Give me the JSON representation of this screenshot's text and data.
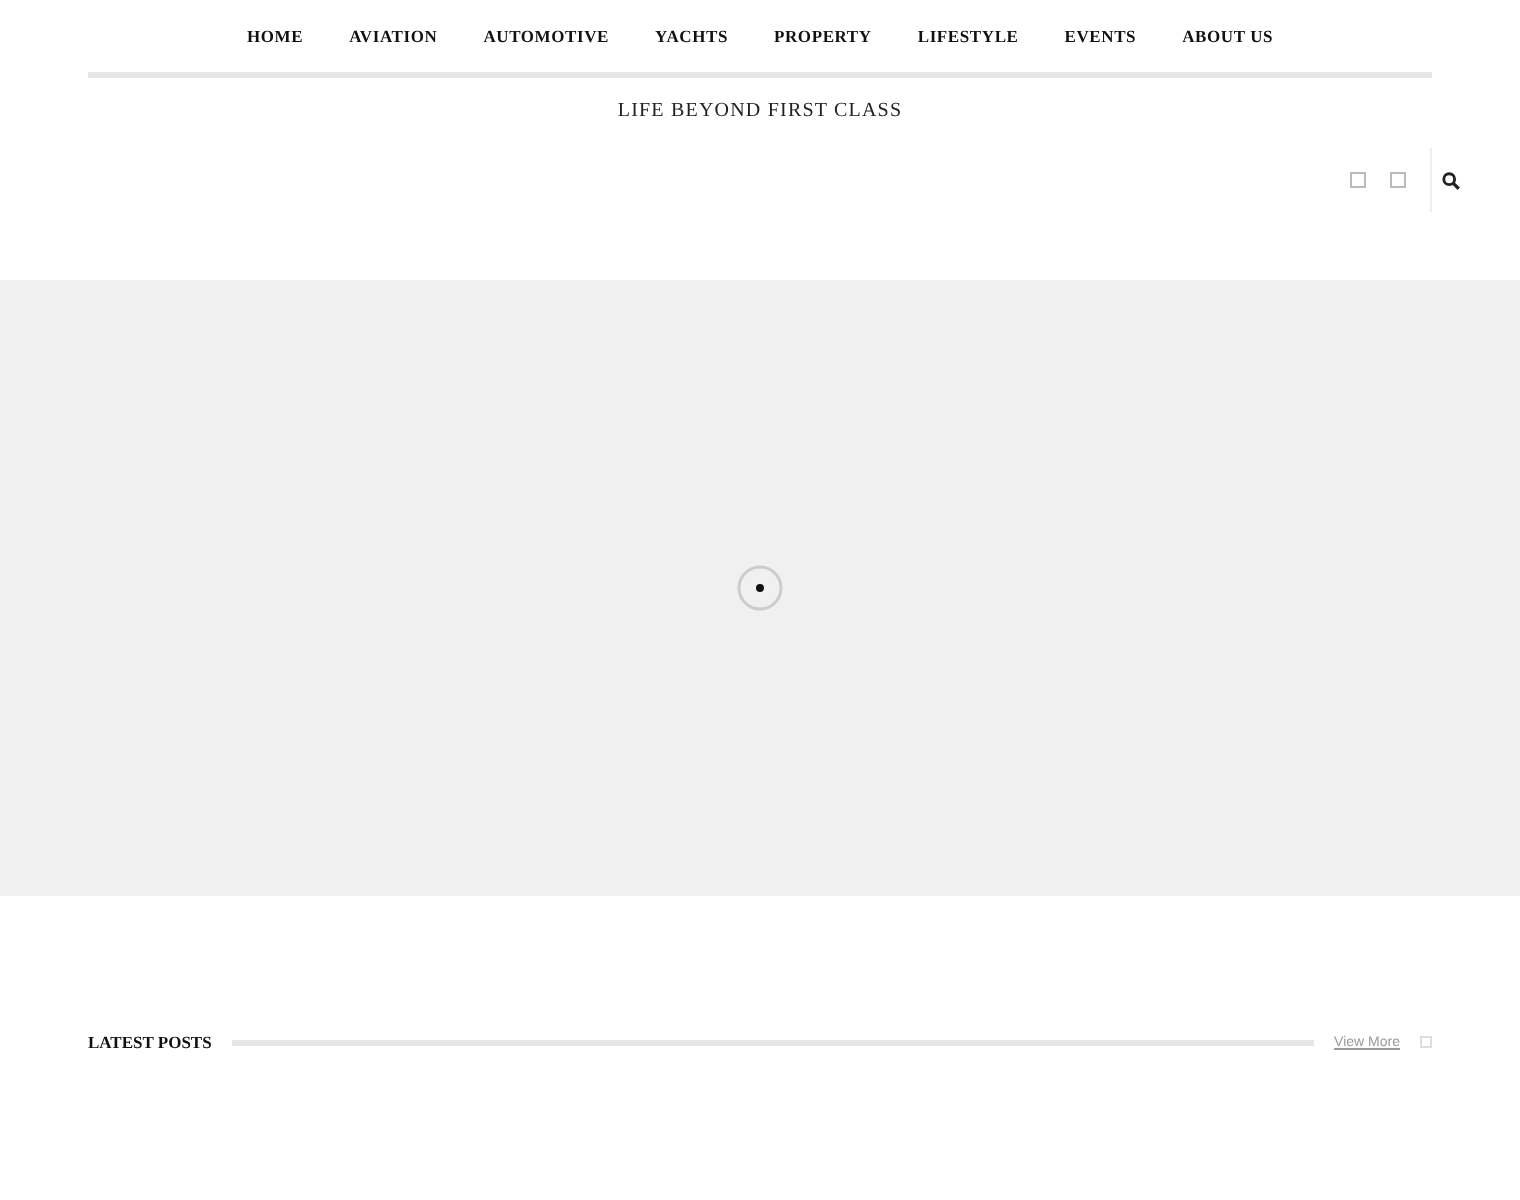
{
  "nav": {
    "items": [
      {
        "label": "HOME"
      },
      {
        "label": "AVIATION"
      },
      {
        "label": "AUTOMOTIVE"
      },
      {
        "label": "YACHTS"
      },
      {
        "label": "PROPERTY"
      },
      {
        "label": "LIFESTYLE"
      },
      {
        "label": "EVENTS"
      },
      {
        "label": "ABOUT US"
      }
    ]
  },
  "tagline": "LIFE BEYOND FIRST CLASS",
  "section": {
    "title": "LATEST POSTS",
    "link": "View More"
  }
}
